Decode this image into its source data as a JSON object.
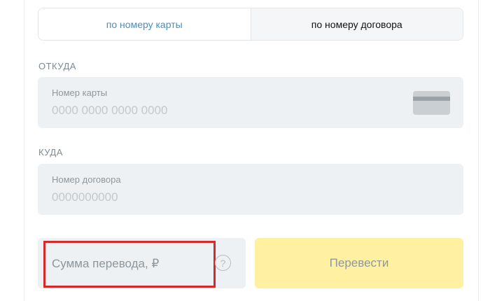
{
  "tabs": {
    "by_card": "по номеру карты",
    "by_contract": "по номеру договора"
  },
  "from": {
    "section_label": "ОТКУДА",
    "field_label": "Номер карты",
    "placeholder": "0000 0000 0000 0000",
    "icon": "bank-card-icon"
  },
  "to": {
    "section_label": "КУДА",
    "field_label": "Номер договора",
    "placeholder": "0000000000"
  },
  "amount": {
    "placeholder": "Сумма перевода, ₽",
    "help": "?"
  },
  "submit": {
    "label": "Перевести"
  },
  "colors": {
    "accent_tab": "#4d8fb8",
    "field_bg": "#edf1f3",
    "button_bg": "#fff1a1",
    "highlight": "#d62a2a"
  }
}
